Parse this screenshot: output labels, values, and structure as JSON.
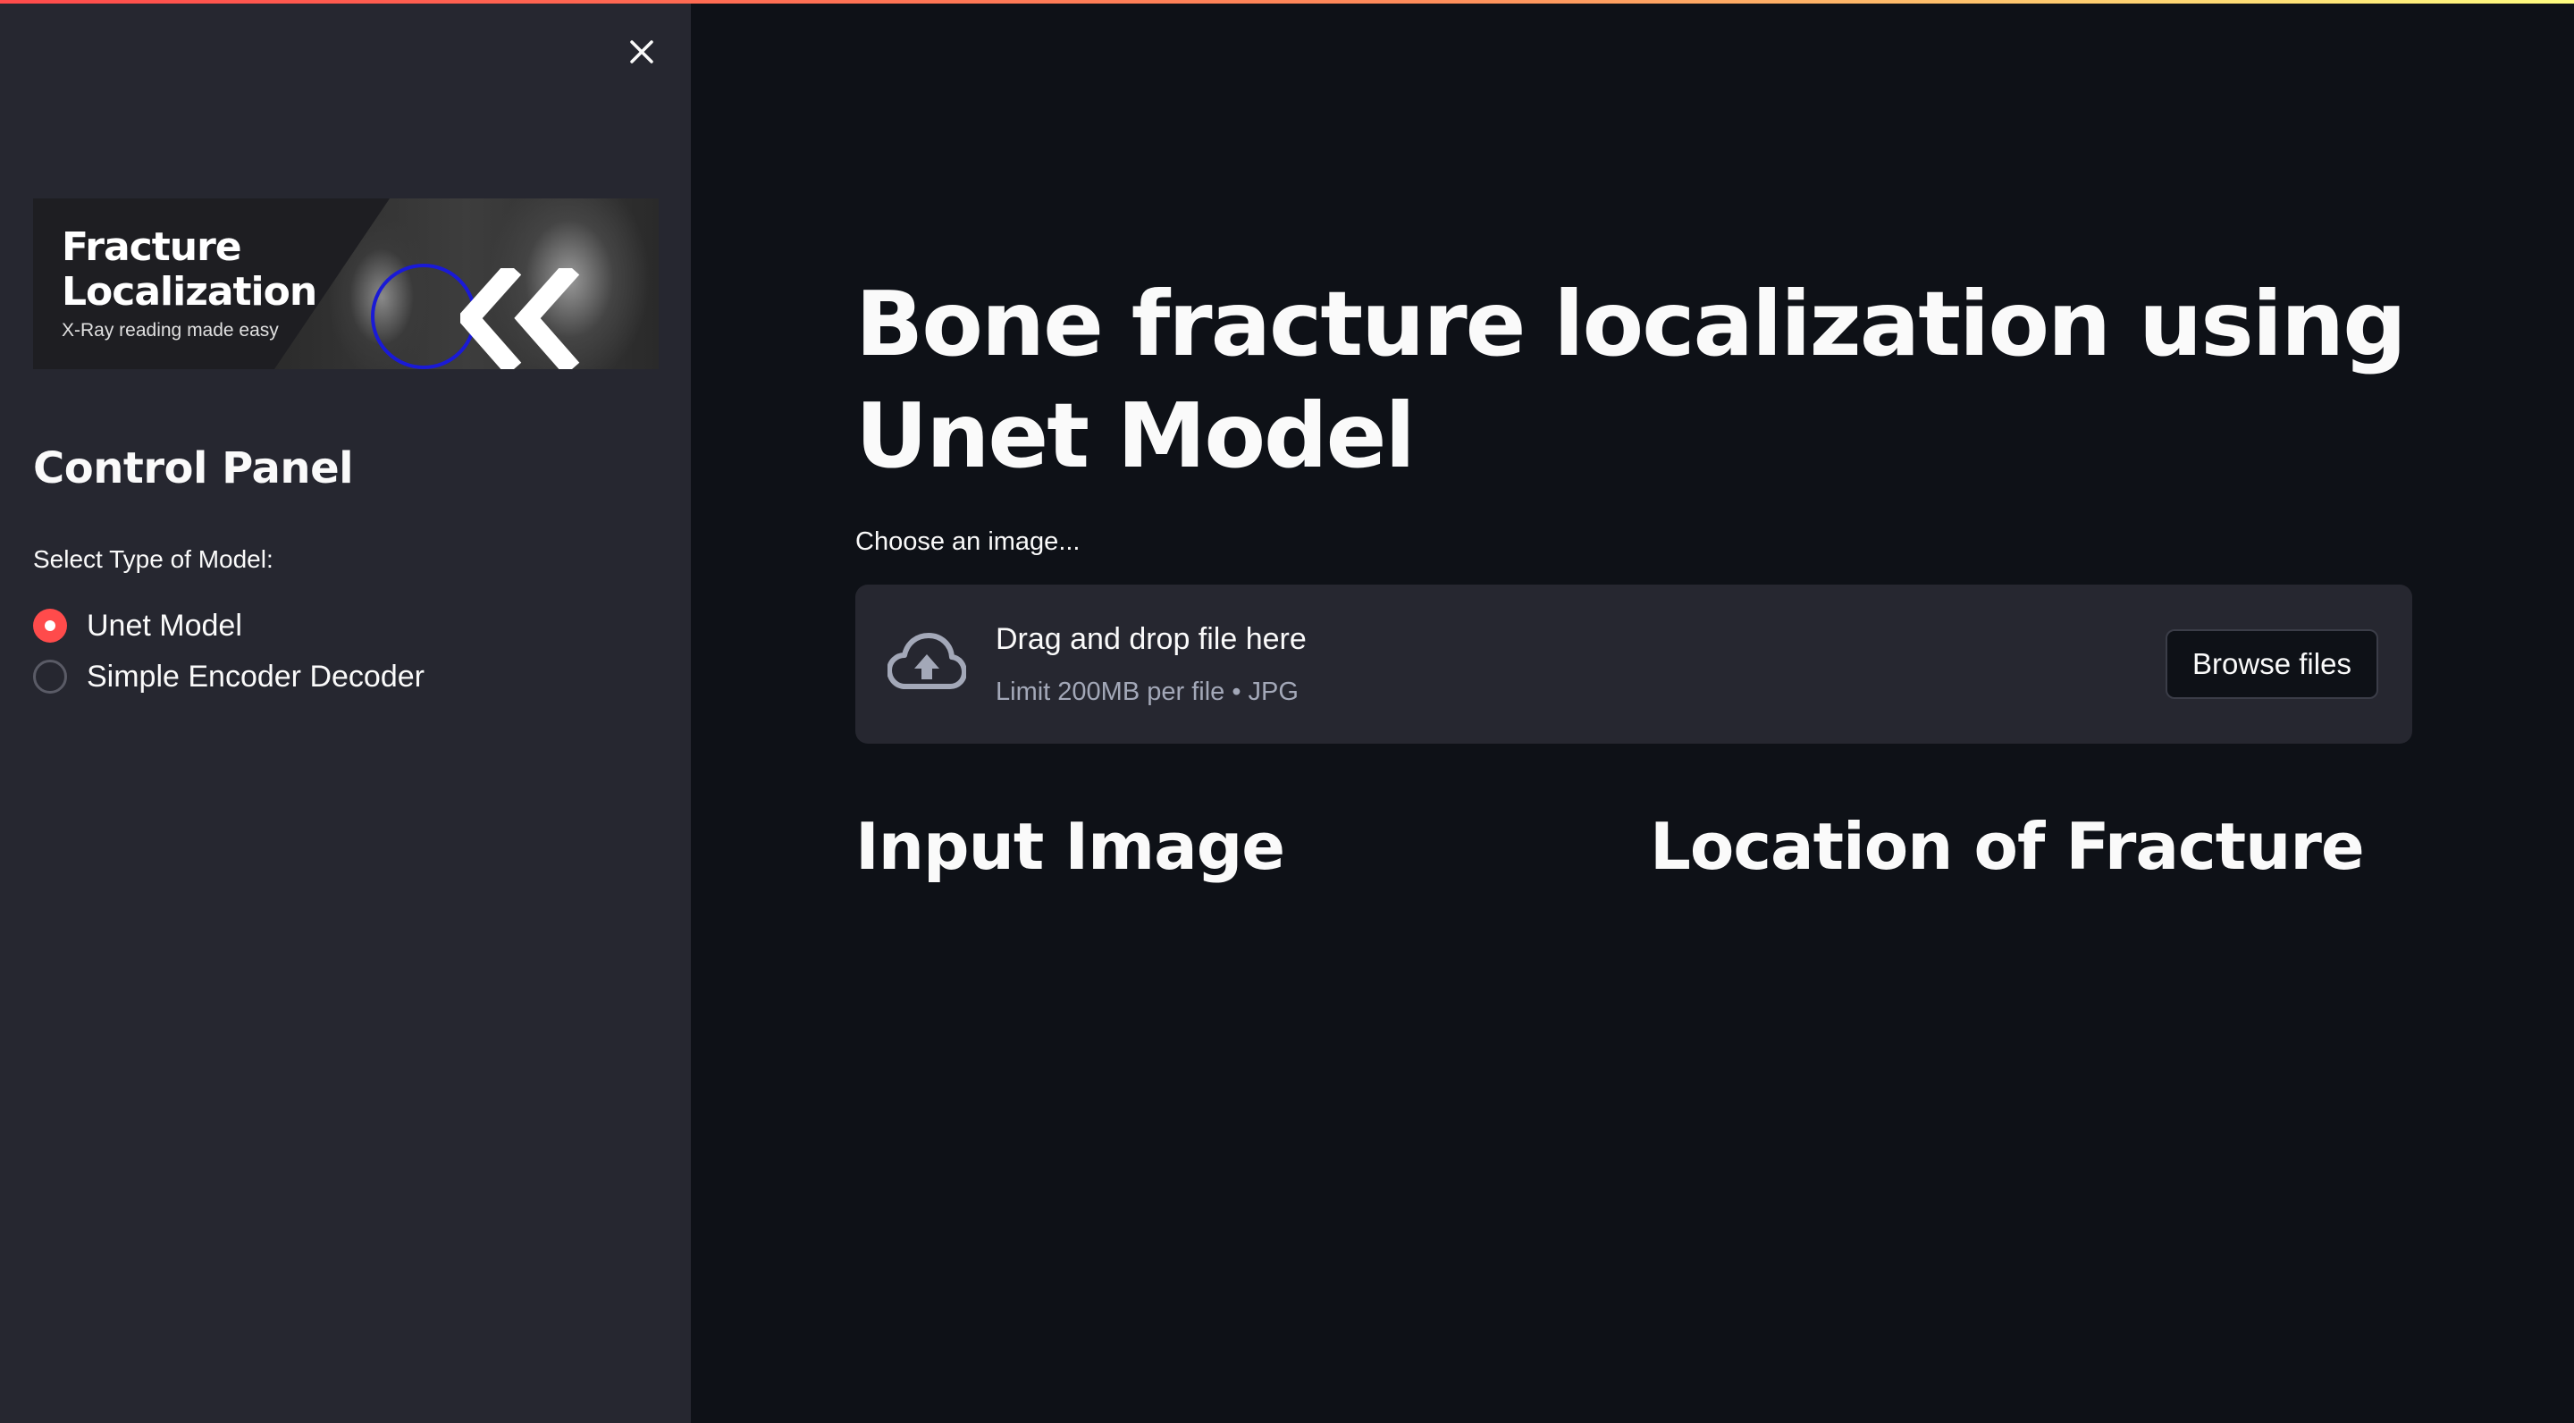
{
  "theme": {
    "accent": "#ff4b4b",
    "background": "#0e1117",
    "sidebar_bg": "#262730"
  },
  "sidebar": {
    "close_icon": "close-icon",
    "banner": {
      "title_line1": "Fracture",
      "title_line2": "Localization",
      "subtitle": "X-Ray reading made easy"
    },
    "heading": "Control Panel",
    "model_select": {
      "label": "Select Type of Model:",
      "options": [
        "Unet Model",
        "Simple Encoder Decoder"
      ],
      "selected": "Unet Model"
    }
  },
  "main": {
    "title": "Bone fracture localization using Unet Model",
    "uploader": {
      "label": "Choose an image...",
      "drop_text": "Drag and drop file here",
      "limit_text": "Limit 200MB per file • JPG",
      "browse_label": "Browse files",
      "icon": "cloud-upload-icon"
    },
    "columns": {
      "left_heading": "Input Image",
      "right_heading": "Location of Fracture"
    }
  }
}
